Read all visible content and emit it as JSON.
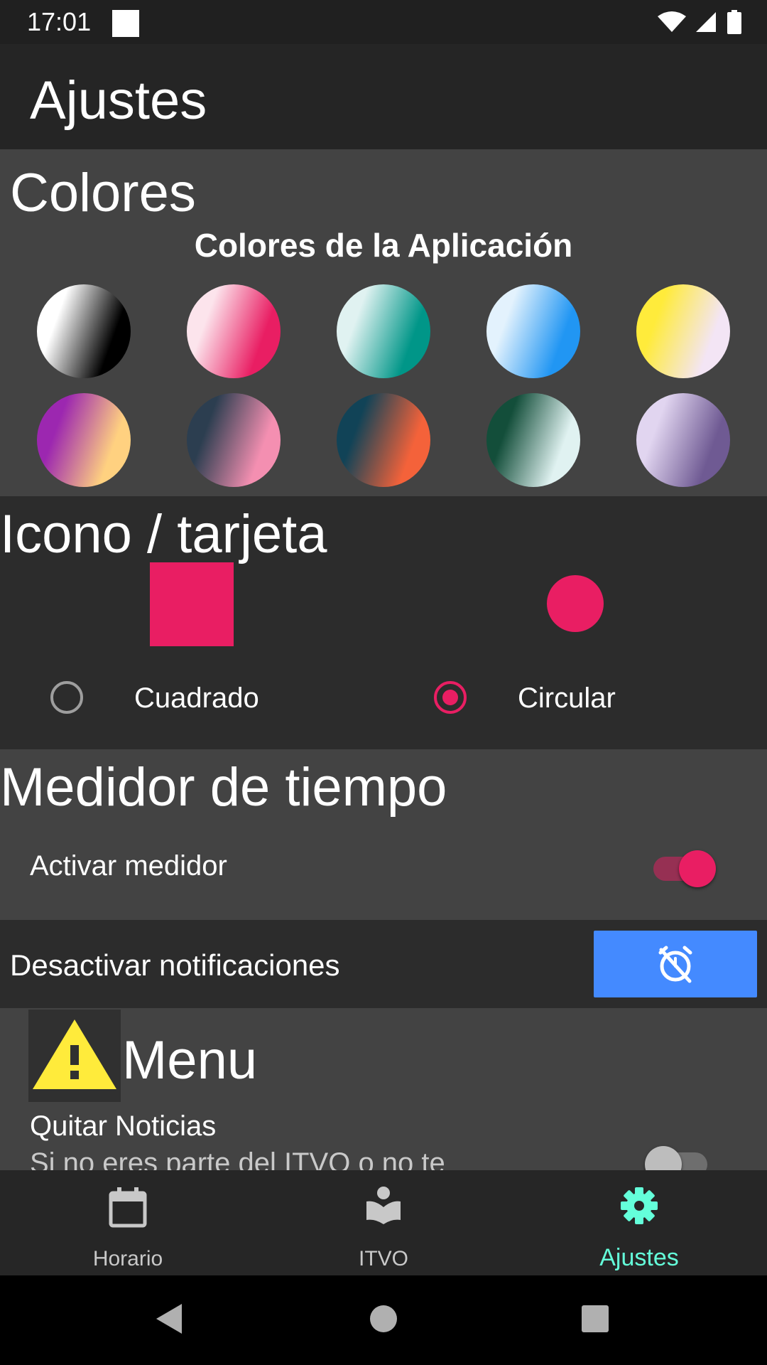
{
  "status_bar": {
    "time": "17:01",
    "icons": [
      "notification-square-icon",
      "wifi-icon",
      "signal-icon",
      "battery-icon"
    ]
  },
  "app_bar": {
    "title": "Ajustes"
  },
  "colores": {
    "title": "Colores",
    "subtitle": "Colores de la Aplicación",
    "swatches": [
      [
        "#ffffff",
        "#000000"
      ],
      [
        "#fce4ec",
        "#e91e63"
      ],
      [
        "#e0f2f1",
        "#009688"
      ],
      [
        "#e3f2fd",
        "#2196f3"
      ],
      [
        "#ffeb3b",
        "#f3e5f5"
      ],
      [
        "#9c27b0",
        "#ffd180"
      ],
      [
        "#2c3e50",
        "#f48fb1"
      ],
      [
        "#114357",
        "#f4623a"
      ],
      [
        "#134e3a",
        "#e0f2f1"
      ],
      [
        "#e1d5f0",
        "#6f5a93"
      ]
    ]
  },
  "icono": {
    "title": "Icono / tarjeta",
    "options": [
      {
        "label": "Cuadrado",
        "selected": false
      },
      {
        "label": "Circular",
        "selected": true
      }
    ],
    "accent": "#e91e63"
  },
  "medidor": {
    "title": "Medidor de tiempo",
    "toggle_label": "Activar medidor",
    "toggle_on": true
  },
  "notificaciones": {
    "label": "Desactivar notificaciones",
    "button_icon": "alarm-off-icon",
    "button_color": "#448aff"
  },
  "menu": {
    "title": "Menu",
    "warning_icon": "warning-icon",
    "item_title": "Quitar Noticias",
    "item_desc": "Si no eres parte del ITVO o no te",
    "toggle_on": false
  },
  "bottom_nav": {
    "items": [
      {
        "label": "Horario",
        "icon": "calendar-icon",
        "active": false
      },
      {
        "label": "ITVO",
        "icon": "book-reader-icon",
        "active": false
      },
      {
        "label": "Ajustes",
        "icon": "gear-icon",
        "active": true
      }
    ],
    "active_color": "#64ffda"
  },
  "system_nav": [
    "back-icon",
    "home-icon",
    "recents-icon"
  ]
}
